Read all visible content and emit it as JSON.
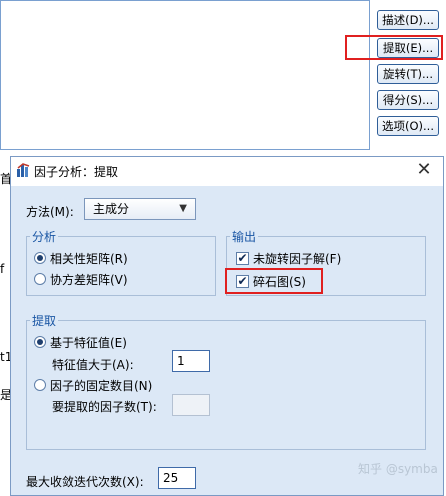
{
  "background": {
    "edge_labels": [
      "首",
      "f",
      "t1",
      "是"
    ],
    "side_buttons": [
      "描述(D)...",
      "提取(E)...",
      "旋转(T)...",
      "得分(S)...",
      "选项(O)..."
    ]
  },
  "dialog": {
    "title": "因子分析：提取",
    "method_label": "方法(M):",
    "method_value": "主成分",
    "analysis": {
      "title": "分析",
      "options": [
        "相关性矩阵(R)",
        "协方差矩阵(V)"
      ],
      "selected_index": 0
    },
    "output": {
      "title": "输出",
      "options": [
        {
          "label": "未旋转因子解(F)",
          "checked": true
        },
        {
          "label": "碎石图(S)",
          "checked": true
        }
      ]
    },
    "extract": {
      "title": "提取",
      "option_eigen": "基于特征值(E)",
      "eigen_label": "特征值大于(A):",
      "eigen_value": "1",
      "option_fixed": "因子的固定数目(N)",
      "factors_label": "要提取的因子数(T):",
      "factors_value": ""
    },
    "max_iter_label": "最大收敛迭代次数(X):",
    "max_iter_value": "25"
  },
  "watermark": "知乎 @symba",
  "colors": {
    "highlight": "#e02020",
    "dialog_bg": "#dce8f6",
    "group_title": "#1a56a4"
  }
}
